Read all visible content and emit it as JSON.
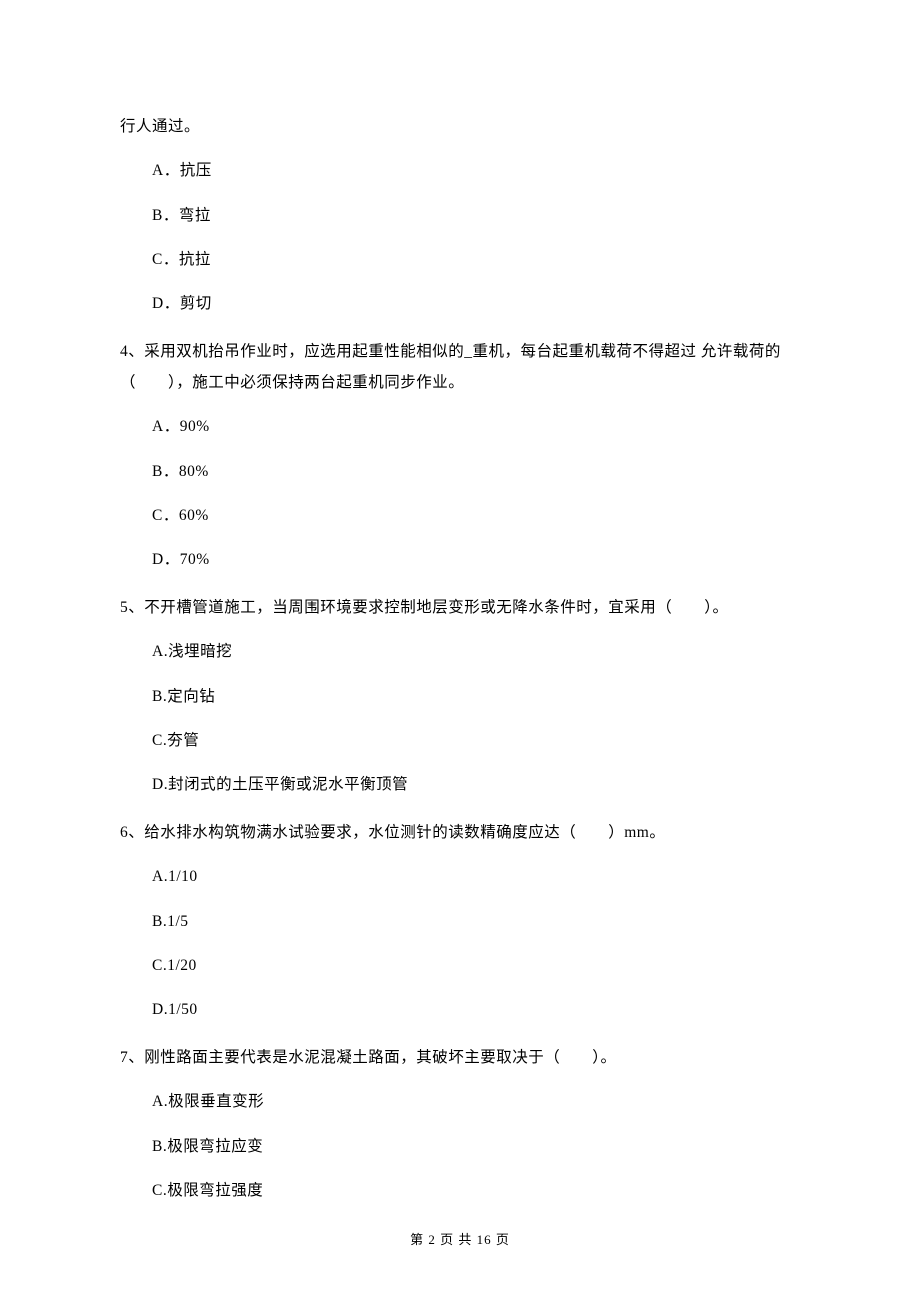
{
  "continuation_line": "行人通过。",
  "q3_options": {
    "a": "A．抗压",
    "b": "B．弯拉",
    "c": "C．抗拉",
    "d": "D．剪切"
  },
  "q4": {
    "text": "4、采用双机抬吊作业时，应选用起重性能相似的_重机，每台起重机载荷不得超过 允许载荷的（　　），施工中必须保持两台起重机同步作业。",
    "options": {
      "a": "A．90%",
      "b": "B．80%",
      "c": "C．60%",
      "d": "D．70%"
    }
  },
  "q5": {
    "text": "5、不开槽管道施工，当周围环境要求控制地层变形或无降水条件时，宜采用（　　）。",
    "options": {
      "a": "A.浅埋暗挖",
      "b": "B.定向钻",
      "c": "C.夯管",
      "d": "D.封闭式的土压平衡或泥水平衡顶管"
    }
  },
  "q6": {
    "text": "6、给水排水构筑物满水试验要求，水位测针的读数精确度应达（　　）mm。",
    "options": {
      "a": "A.1/10",
      "b": "B.1/5",
      "c": "C.1/20",
      "d": "D.1/50"
    }
  },
  "q7": {
    "text": "7、刚性路面主要代表是水泥混凝土路面，其破坏主要取决于（　　）。",
    "options": {
      "a": "A.极限垂直变形",
      "b": "B.极限弯拉应变",
      "c": "C.极限弯拉强度"
    }
  },
  "footer": "第 2 页 共 16 页"
}
